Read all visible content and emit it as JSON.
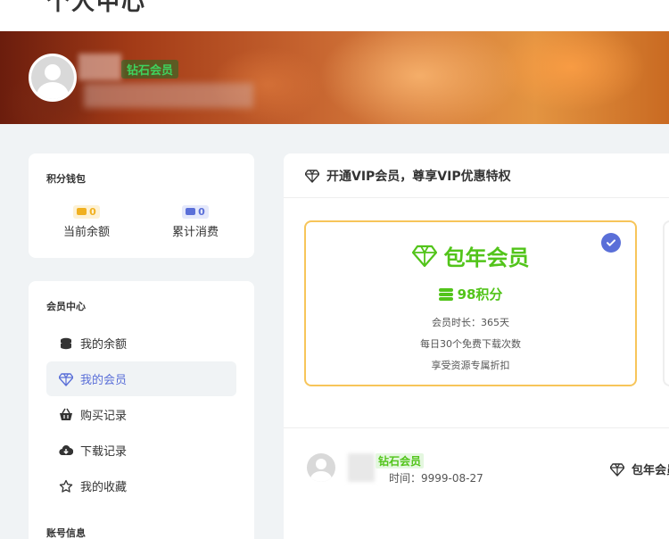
{
  "page": {
    "title": "个人中心"
  },
  "banner": {
    "vip_level": "钻石会员"
  },
  "wallet": {
    "title": "积分钱包",
    "balance_value": "0",
    "balance_label": "当前余额",
    "spent_value": "0",
    "spent_label": "累计消费"
  },
  "member_center": {
    "title": "会员中心",
    "items": [
      {
        "label": "我的余额",
        "icon": "coins-icon"
      },
      {
        "label": "我的会员",
        "icon": "diamond-icon"
      },
      {
        "label": "购买记录",
        "icon": "basket-icon"
      },
      {
        "label": "下载记录",
        "icon": "cloud-download-icon"
      },
      {
        "label": "我的收藏",
        "icon": "star-icon"
      }
    ],
    "active_index": 1
  },
  "account": {
    "title": "账号信息"
  },
  "vip": {
    "header": "开通VIP会员，尊享VIP优惠特权",
    "plan": {
      "name": "包年会员",
      "price": "98积分",
      "duration": "会员时长：365天",
      "downloads": "每日30个免费下载次数",
      "discount": "享受资源专属折扣",
      "selected": true
    },
    "current": {
      "level": "钻石会员",
      "expire": "时间：9999-08-27",
      "plan_name": "包年会员"
    }
  },
  "colors": {
    "accent": "#5a6fd8",
    "vip_green": "#52c41a",
    "plan_border": "#f7c55a"
  }
}
